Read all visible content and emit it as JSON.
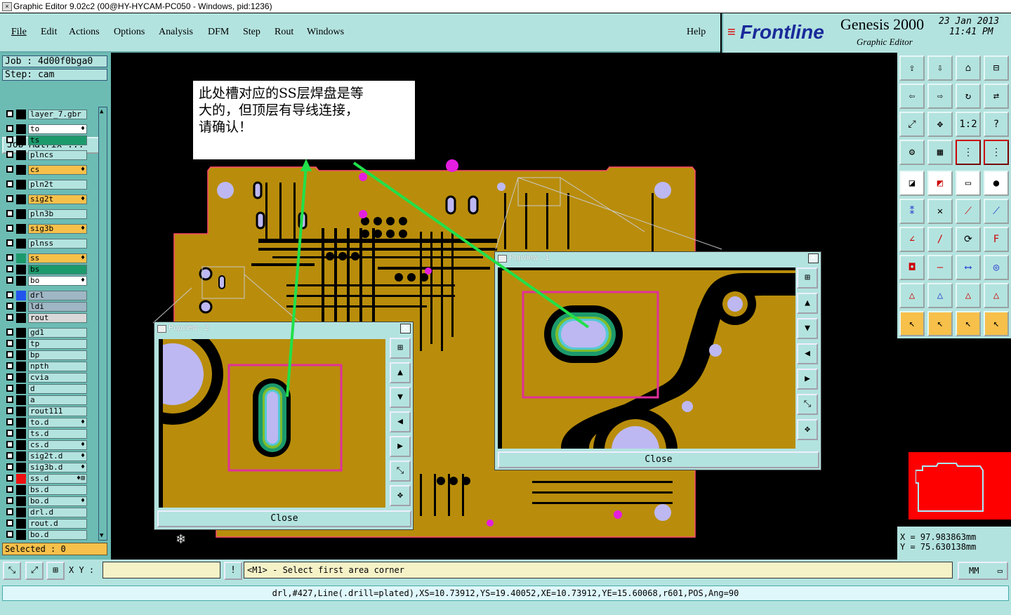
{
  "window": {
    "title": "Graphic Editor 9.02c2 (00@HY-HYCAM-PC050 - Windows, pid:1236)"
  },
  "menu": [
    "File",
    "Edit",
    "Actions",
    "Options",
    "Analysis",
    "DFM",
    "Step",
    "Rout",
    "Windows"
  ],
  "help": "Help",
  "brand": {
    "logo": "Frontline",
    "product": "Genesis 2000",
    "subtitle": "Graphic Editor",
    "date": "23 Jan 2013",
    "time": "11:41 PM"
  },
  "job": {
    "job": "Job : 4d00f0bga0",
    "step": "Step: cam",
    "matrix_button": "Job Matrix ..."
  },
  "layers": [
    {
      "name": "layer_7.gbr",
      "color": "#000000",
      "mark": ""
    },
    {
      "name": "to",
      "color": "#000000",
      "mark": "♦",
      "bg": "#ffffff"
    },
    {
      "name": "ts",
      "color": "#000000",
      "mark": "",
      "bg": "#1c9a6c"
    },
    {
      "name": "plncs",
      "color": "#000000",
      "mark": ""
    },
    {
      "name": "cs",
      "color": "#000000",
      "mark": "♦",
      "bg": "#f7c04a"
    },
    {
      "name": "pln2t",
      "color": "#000000",
      "mark": ""
    },
    {
      "name": "sig2t",
      "color": "#000000",
      "mark": "♦",
      "bg": "#f7c04a"
    },
    {
      "name": "pln3b",
      "color": "#000000",
      "mark": ""
    },
    {
      "name": "sig3b",
      "color": "#000000",
      "mark": "♦",
      "bg": "#f7c04a"
    },
    {
      "name": "plnss",
      "color": "#000000",
      "mark": ""
    },
    {
      "name": "ss",
      "color": "#1c9a6c",
      "mark": "♦",
      "bg": "#f7c04a"
    },
    {
      "name": "bs",
      "color": "#000000",
      "mark": "",
      "bg": "#1c9a6c"
    },
    {
      "name": "bo",
      "color": "#000000",
      "mark": "♦",
      "bg": "#ffffff"
    },
    {
      "name": "drl",
      "color": "#2255ee",
      "mark": "",
      "bg": "#9fb6c4"
    },
    {
      "name": "ldi",
      "color": "#000000",
      "mark": "",
      "bg": "#9fb6c4"
    },
    {
      "name": "rout",
      "color": "#000000",
      "mark": "",
      "bg": "#d9d9d9"
    },
    {
      "name": "gd1",
      "color": "#000000",
      "mark": ""
    },
    {
      "name": "tp",
      "color": "#000000",
      "mark": ""
    },
    {
      "name": "bp",
      "color": "#000000",
      "mark": ""
    },
    {
      "name": "npth",
      "color": "#000000",
      "mark": ""
    },
    {
      "name": "cvia",
      "color": "#000000",
      "mark": ""
    },
    {
      "name": "d",
      "color": "#000000",
      "mark": ""
    },
    {
      "name": "a",
      "color": "#000000",
      "mark": ""
    },
    {
      "name": "rout111",
      "color": "#000000",
      "mark": ""
    },
    {
      "name": "to.d",
      "color": "#000000",
      "mark": "♦"
    },
    {
      "name": "ts.d",
      "color": "#000000",
      "mark": ""
    },
    {
      "name": "cs.d",
      "color": "#000000",
      "mark": "♦"
    },
    {
      "name": "sig2t.d",
      "color": "#000000",
      "mark": "♦"
    },
    {
      "name": "sig3b.d",
      "color": "#000000",
      "mark": "♦"
    },
    {
      "name": "ss.d",
      "color": "#ee1111",
      "mark": "♦⊞"
    },
    {
      "name": "bs.d",
      "color": "#000000",
      "mark": ""
    },
    {
      "name": "bo.d",
      "color": "#000000",
      "mark": "♦"
    },
    {
      "name": "drl.d",
      "color": "#000000",
      "mark": ""
    },
    {
      "name": "rout.d",
      "color": "#000000",
      "mark": ""
    },
    {
      "name": "bo.d",
      "color": "#000000",
      "mark": ""
    }
  ],
  "selected": "Selected : 0",
  "note": "此处槽对应的SS层焊盘是等\n大的，但顶层有导线连接，\n请确认！",
  "popview2": {
    "title": "Popview - 2",
    "close": "Close"
  },
  "popview1": {
    "title": "Popview - 1",
    "close": "Close"
  },
  "coords": {
    "x": "X  =  97.983863mm",
    "y": "Y  =  75.630138mm"
  },
  "xy_label": "X Y :",
  "message": "<M1> - Select first area corner",
  "units": "MM",
  "status": "drl,#427,Line(.drill=plated),XS=10.73912,YS=19.40052,XE=10.73912,YE=15.60068,r601,POS,Ang=90",
  "colors": {
    "panel": "#b3e3df",
    "copper": "#b98d0b",
    "accent": "#f7c04a",
    "pad": "#bdb8f2",
    "via": "#e41ee0"
  }
}
